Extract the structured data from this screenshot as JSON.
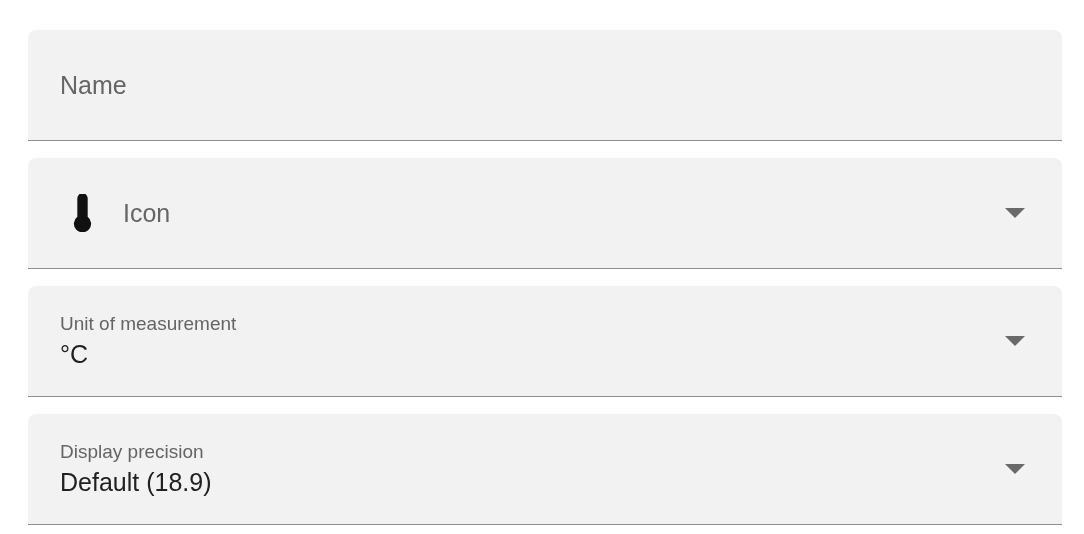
{
  "fields": [
    {
      "kind": "text",
      "placeholder": "Name"
    },
    {
      "kind": "select",
      "label": "Icon",
      "leading_icon": true
    },
    {
      "kind": "select",
      "label": "Unit of measurement",
      "value": "°C"
    },
    {
      "kind": "select",
      "label": "Display precision",
      "value": "Default (18.9)"
    }
  ]
}
